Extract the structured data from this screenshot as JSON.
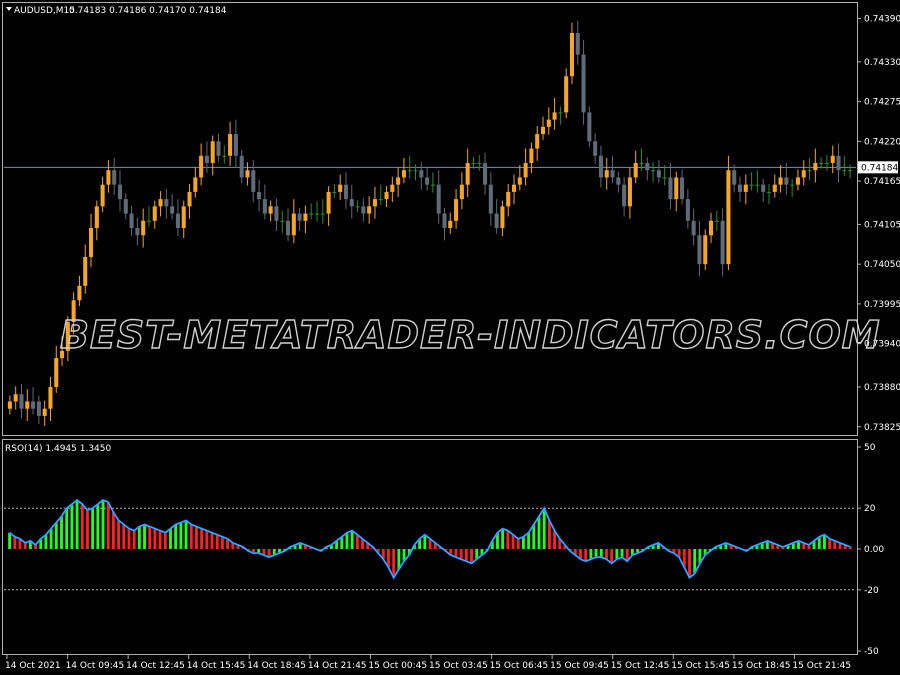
{
  "header": {
    "symbol": "AUDUSD,M15",
    "ohlc": "0.74183 0.74186 0.74170 0.74184"
  },
  "watermark": "BEST-METATRADER-INDICATORS.COM",
  "colors": {
    "background": "#000000",
    "axis": "#b0b0b0",
    "bull_candle": "#f5a623",
    "bear_candle": "#5f6b78",
    "doji_candle": "#2e8b2e",
    "price_line": "#7a8fa8",
    "current_price_box": "#ffffff",
    "hist_up": "#22ff22",
    "hist_down": "#ff2222",
    "rso_line": "#2f6bff",
    "rso_line_highlight": "#23d3ff",
    "level_lines": "#b0b0b0"
  },
  "chart_data": [
    {
      "type": "candlestick",
      "name": "price",
      "y_ticks": [
        "0.74390",
        "0.74330",
        "0.74275",
        "0.74220",
        "0.74165",
        "0.74105",
        "0.74050",
        "0.73995",
        "0.73940",
        "0.73880",
        "0.73825"
      ],
      "ylim": [
        0.73815,
        0.7441
      ],
      "current_price": 0.74184,
      "current_price_label": "0.74184",
      "x_ticks": [
        "14 Oct 2021",
        "14 Oct 09:45",
        "14 Oct 12:45",
        "14 Oct 15:45",
        "14 Oct 18:45",
        "14 Oct 21:45",
        "15 Oct 00:45",
        "15 Oct 03:45",
        "15 Oct 06:45",
        "15 Oct 09:45",
        "15 Oct 12:45",
        "15 Oct 15:45",
        "15 Oct 18:45",
        "15 Oct 21:45"
      ],
      "close": [
        0.7386,
        0.7387,
        0.7385,
        0.7386,
        0.7385,
        0.7384,
        0.7385,
        0.7388,
        0.7392,
        0.7393,
        0.7397,
        0.74,
        0.7402,
        0.7406,
        0.741,
        0.7413,
        0.7416,
        0.7418,
        0.7416,
        0.7414,
        0.7412,
        0.741,
        0.7409,
        0.7411,
        0.7411,
        0.7413,
        0.7414,
        0.7413,
        0.7412,
        0.741,
        0.7413,
        0.7415,
        0.7417,
        0.742,
        0.7419,
        0.7422,
        0.742,
        0.742,
        0.7423,
        0.742,
        0.7417,
        0.7418,
        0.7415,
        0.7414,
        0.7412,
        0.7413,
        0.7411,
        0.7411,
        0.7409,
        0.7412,
        0.7411,
        0.7412,
        0.7412,
        0.7412,
        0.7412,
        0.7415,
        0.7415,
        0.7416,
        0.7414,
        0.7413,
        0.7413,
        0.7412,
        0.7413,
        0.7414,
        0.7414,
        0.7415,
        0.7416,
        0.7417,
        0.7418,
        0.7418,
        0.7418,
        0.7417,
        0.7416,
        0.7416,
        0.7412,
        0.741,
        0.7411,
        0.7414,
        0.7416,
        0.7419,
        0.7419,
        0.7419,
        0.7416,
        0.7412,
        0.741,
        0.7413,
        0.7415,
        0.7416,
        0.7417,
        0.7419,
        0.7421,
        0.7423,
        0.7424,
        0.7425,
        0.7426,
        0.7426,
        0.7431,
        0.7437,
        0.7434,
        0.7426,
        0.7422,
        0.742,
        0.7417,
        0.7418,
        0.7417,
        0.7416,
        0.7413,
        0.7417,
        0.7419,
        0.7419,
        0.7418,
        0.7418,
        0.7417,
        0.7417,
        0.7414,
        0.7417,
        0.7414,
        0.7411,
        0.7409,
        0.7405,
        0.7409,
        0.7411,
        0.7411,
        0.7405,
        0.7418,
        0.7416,
        0.7415,
        0.7416,
        0.7416,
        0.7416,
        0.7415,
        0.7415,
        0.7416,
        0.7417,
        0.7416,
        0.7416,
        0.7417,
        0.7418,
        0.7418,
        0.7419,
        0.7419,
        0.7419,
        0.742,
        0.7418,
        0.7418,
        0.7418
      ],
      "open": [
        0.7385,
        0.7386,
        0.7387,
        0.7385,
        0.7386,
        0.7386,
        0.7384,
        0.7385,
        0.7388,
        0.7392,
        0.7393,
        0.7397,
        0.74,
        0.7402,
        0.7406,
        0.741,
        0.7413,
        0.7416,
        0.7418,
        0.7416,
        0.7414,
        0.7412,
        0.741,
        0.7409,
        0.7411,
        0.7411,
        0.7413,
        0.7414,
        0.7413,
        0.7412,
        0.741,
        0.7413,
        0.7415,
        0.7417,
        0.742,
        0.7419,
        0.7422,
        0.742,
        0.742,
        0.7423,
        0.742,
        0.7417,
        0.7418,
        0.7415,
        0.7414,
        0.7412,
        0.7413,
        0.7411,
        0.7411,
        0.7409,
        0.7412,
        0.7411,
        0.7412,
        0.7412,
        0.7412,
        0.7412,
        0.7415,
        0.7415,
        0.7416,
        0.7414,
        0.7413,
        0.7413,
        0.7412,
        0.7413,
        0.7414,
        0.7414,
        0.7415,
        0.7416,
        0.7417,
        0.7418,
        0.7418,
        0.7418,
        0.7417,
        0.7416,
        0.7416,
        0.7412,
        0.741,
        0.7411,
        0.7414,
        0.7416,
        0.7419,
        0.7419,
        0.7419,
        0.7416,
        0.7412,
        0.741,
        0.7413,
        0.7415,
        0.7416,
        0.7417,
        0.7419,
        0.7421,
        0.7423,
        0.7424,
        0.7425,
        0.7426,
        0.7426,
        0.7431,
        0.7437,
        0.7434,
        0.7426,
        0.7422,
        0.742,
        0.7417,
        0.7418,
        0.7417,
        0.7416,
        0.7413,
        0.7417,
        0.7419,
        0.7419,
        0.7418,
        0.7418,
        0.7417,
        0.7417,
        0.7414,
        0.7417,
        0.7414,
        0.7411,
        0.7409,
        0.7405,
        0.7409,
        0.7411,
        0.7411,
        0.7405,
        0.7418,
        0.7416,
        0.7415,
        0.7416,
        0.7416,
        0.7416,
        0.7415,
        0.7415,
        0.7416,
        0.7417,
        0.7416,
        0.7416,
        0.7417,
        0.7418,
        0.7418,
        0.7419,
        0.7419,
        0.7419,
        0.742,
        0.7418,
        0.7418
      ]
    },
    {
      "type": "bar",
      "name": "RSO(14)",
      "label": "RSO(14) 1.4945 1.3450",
      "y_ticks": [
        "50",
        "20",
        "0.00",
        "-20",
        "-50"
      ],
      "ylim": [
        -50,
        50
      ],
      "levels": [
        20,
        -20
      ],
      "values": [
        8,
        6,
        5,
        3,
        4,
        2,
        5,
        7,
        10,
        13,
        16,
        20,
        22,
        24,
        22,
        19,
        20,
        22,
        24,
        23,
        18,
        14,
        12,
        10,
        9,
        11,
        12,
        11,
        10,
        9,
        8,
        10,
        12,
        13,
        14,
        12,
        11,
        10,
        9,
        8,
        7,
        6,
        5,
        3,
        2,
        1,
        -1,
        -2,
        -2,
        -3,
        -4,
        -3,
        -2,
        -1,
        1,
        2,
        3,
        2,
        1,
        0,
        -1,
        1,
        2,
        4,
        6,
        8,
        9,
        7,
        5,
        3,
        1,
        -2,
        -5,
        -9,
        -14,
        -10,
        -6,
        -3,
        2,
        5,
        7,
        5,
        3,
        1,
        -1,
        -3,
        -4,
        -5,
        -6,
        -7,
        -5,
        -3,
        -1,
        4,
        8,
        10,
        9,
        7,
        5,
        6,
        8,
        12,
        16,
        20,
        14,
        9,
        5,
        2,
        -1,
        -3,
        -5,
        -6,
        -5,
        -4,
        -4,
        -5,
        -7,
        -5,
        -4,
        -6,
        -3,
        -2,
        -1,
        1,
        2,
        3,
        1,
        -1,
        -2,
        -4,
        -9,
        -14,
        -12,
        -7,
        -3,
        -1,
        1,
        2,
        3,
        2,
        1,
        0,
        -1,
        1,
        2,
        3,
        4,
        3,
        2,
        1,
        2,
        3,
        4,
        3,
        2,
        4,
        6,
        7,
        5,
        4,
        3,
        2,
        1
      ]
    }
  ]
}
